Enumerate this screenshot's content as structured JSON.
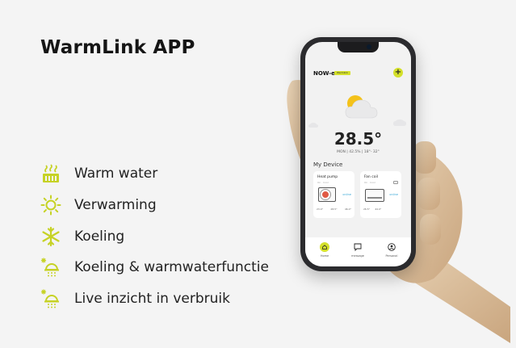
{
  "title": "WarmLink APP",
  "accent_color": "#d4e02a",
  "features": [
    {
      "icon": "warm-water-icon",
      "label": "Warm water"
    },
    {
      "icon": "sun-icon",
      "label": "Verwarming"
    },
    {
      "icon": "snowflake-icon",
      "label": "Koeling"
    },
    {
      "icon": "sun-snow-dome-icon",
      "label": "Koeling & warmwaterfunctie"
    },
    {
      "icon": "sun-snow-dome-icon",
      "label": "Live inzicht in verbruik"
    }
  ],
  "phone": {
    "brand": "NOW-e",
    "badge": "Warmlink",
    "temperature": "28.5°",
    "info": "MON  |  42.5%  |  18°- 32°",
    "section_title": "My Device",
    "devices": [
      {
        "name": "Heat pump",
        "state": "On · Cool",
        "status": "online",
        "stats": [
          "23.0°",
          "28.5°",
          "46.0°"
        ]
      },
      {
        "name": "Fan coil",
        "state": "On · Cool",
        "status": "online",
        "stats": [
          "26.5°",
          "44.0°"
        ]
      }
    ],
    "tabs": [
      {
        "label": "Home",
        "icon": "home-icon"
      },
      {
        "label": "message",
        "icon": "message-icon"
      },
      {
        "label": "Personal",
        "icon": "person-icon"
      }
    ]
  }
}
